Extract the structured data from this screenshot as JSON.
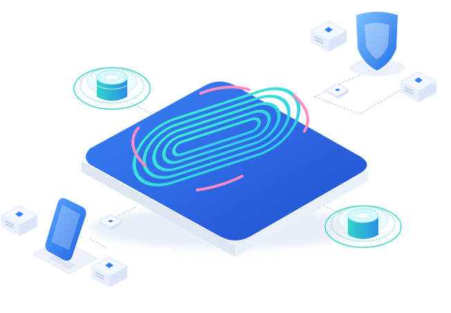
{
  "scene": {
    "subject": "fingerprint-security-network",
    "colors": {
      "platform_top": "#2f6fe6",
      "platform_edge": "#e7ecf6",
      "fingerprint": "#3fe0d6",
      "arc_pink": "#ff7ab8",
      "device_accent": "#2f80ff",
      "shield": "#2b7df6",
      "glow_ring": "#2bd0c0"
    },
    "icons": [
      "fingerprint-icon",
      "shield-icon",
      "smartphone-icon",
      "database-icon",
      "server-icon",
      "chip-icon"
    ]
  }
}
